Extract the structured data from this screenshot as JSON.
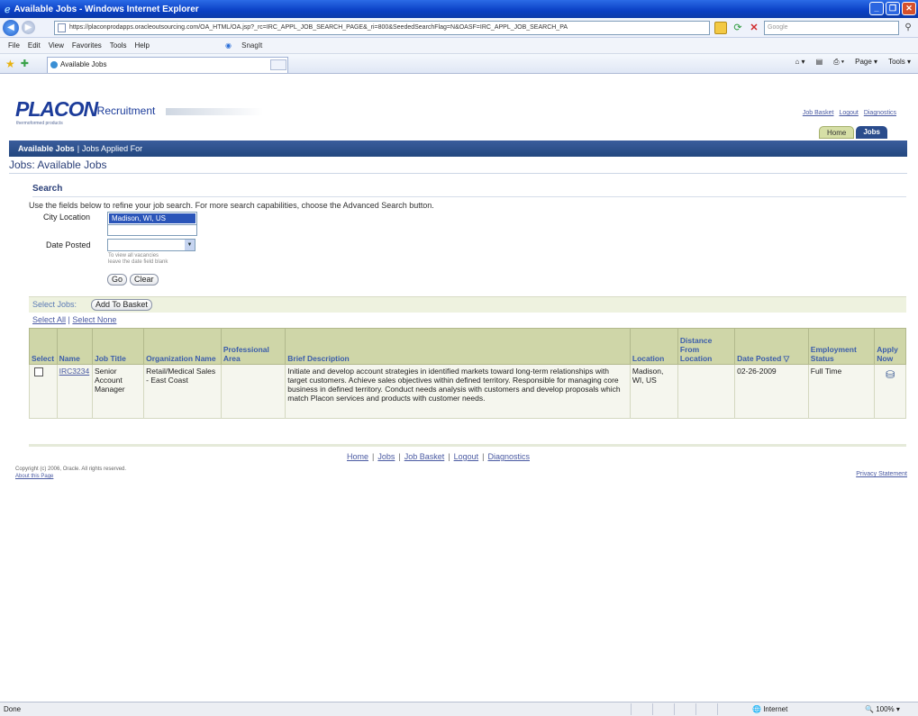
{
  "window": {
    "title": "Available Jobs - Windows Internet Explorer",
    "minimize": "_",
    "restore": "❐",
    "close": "✕"
  },
  "addressbar": {
    "url": "https://placonprodapps.oracleoutsourcing.com/OA_HTML/OA.jsp?_rc=IRC_APPL_JOB_SEARCH_PAGE&_ri=800&SeededSearchFlag=N&OASF=IRC_APPL_JOB_SEARCH_PA",
    "search_placeholder": "Google"
  },
  "menubar": {
    "items": [
      "File",
      "Edit",
      "View",
      "Favorites",
      "Tools",
      "Help"
    ],
    "snagit": "SnagIt"
  },
  "tabbar": {
    "tab_label": "Available Jobs",
    "page_menu": "Page",
    "tools_menu": "Tools"
  },
  "header": {
    "brand": "PLACON",
    "product": "iRecruitment",
    "tagline": "thermoformed products",
    "global_links": [
      "Job Basket",
      "Logout",
      "Diagnostics"
    ],
    "tabs": [
      "Home",
      "Jobs"
    ]
  },
  "subnav": {
    "active": "Available Jobs",
    "other": "Jobs Applied For"
  },
  "page": {
    "title": "Jobs: Available Jobs"
  },
  "search": {
    "heading": "Search",
    "instructions": "Use the fields below to refine your job search.  For more search capabilities, choose the Advanced Search button.",
    "city_label": "City Location",
    "city_selected": "Madison, WI, US",
    "date_label": "Date Posted",
    "date_value": "",
    "hint": "To view all vacancies\nleave the date field blank",
    "go": "Go",
    "clear": "Clear"
  },
  "results": {
    "select_label": "Select Jobs:",
    "add_to_basket": "Add To Basket",
    "select_all": "Select All",
    "select_none": "Select None",
    "columns": [
      "Select",
      "Name",
      "Job Title",
      "Organization Name",
      "Professional Area",
      "Brief Description",
      "Location",
      "Distance From Location",
      "Date Posted",
      "Employment Status",
      "Apply Now"
    ],
    "rows": [
      {
        "name": "IRC3234",
        "job_title": "Senior Account Manager",
        "organization": "Retail/Medical Sales - East Coast",
        "professional_area": "",
        "description": "Initiate and develop account strategies in identified markets toward long-term relationships with target customers.  Achieve sales objectives within defined territory.  Responsible for managing core business in defined territory.  Conduct needs analysis with customers and develop proposals which match Placon services and products with customer needs.",
        "location": "Madison, WI, US",
        "distance": "",
        "date_posted": "02-26-2009",
        "employment_status": "Full Time"
      }
    ]
  },
  "footer": {
    "links": [
      "Home",
      "Jobs",
      "Job Basket",
      "Logout",
      "Diagnostics"
    ],
    "copyright": "Copyright (c) 2006, Oracle. All rights reserved.",
    "about": "About this Page",
    "privacy": "Privacy Statement"
  },
  "statusbar": {
    "status": "Done",
    "zone": "Internet",
    "zoom": "100%"
  }
}
